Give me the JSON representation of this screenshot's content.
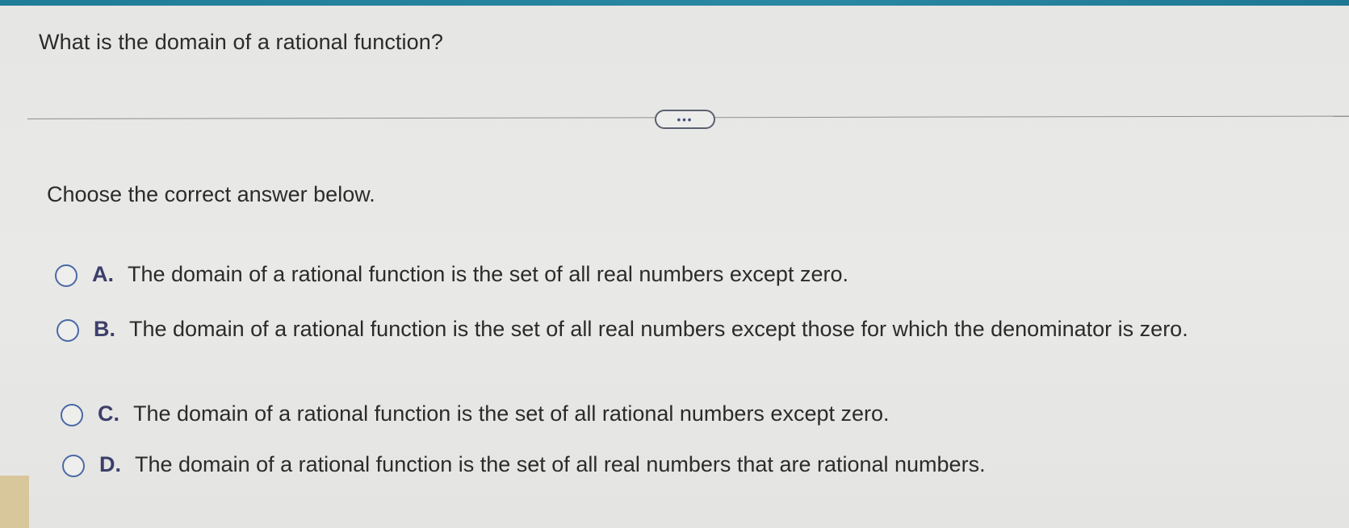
{
  "question": "What is the domain of a rational function?",
  "more_button_label": "•••",
  "instruction": "Choose the correct answer below.",
  "options": [
    {
      "letter": "A.",
      "text": "The domain of a rational function is the set of all real numbers except zero."
    },
    {
      "letter": "B.",
      "text": "The domain of a rational function is the set of all real numbers except those for which the denominator is zero."
    },
    {
      "letter": "C.",
      "text": "The domain of a rational function is the set of all rational numbers except zero."
    },
    {
      "letter": "D.",
      "text": "The domain of a rational function is the set of all real numbers that are rational numbers."
    }
  ],
  "colors": {
    "top_bar": "#1f7d97",
    "radio_border": "#4a6aa6",
    "option_letter": "#3c3f6a"
  }
}
